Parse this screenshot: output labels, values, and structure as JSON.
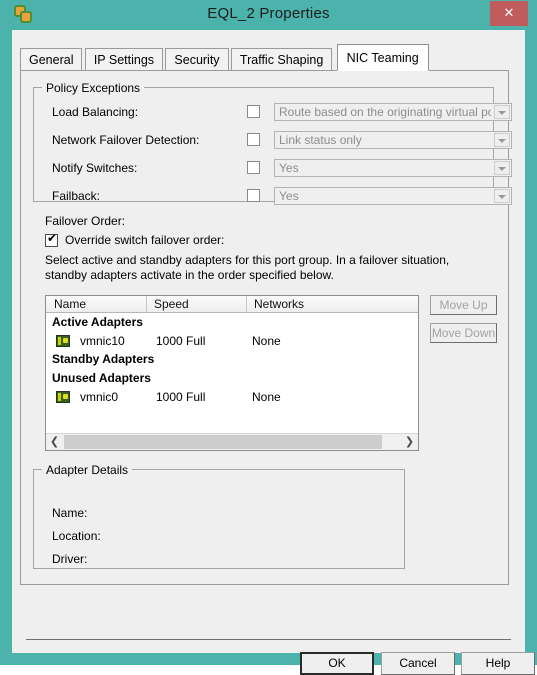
{
  "window": {
    "title": "EQL_2 Properties",
    "icon": "vsphere-link-icon",
    "close_label": "✕",
    "accent_color": "#4cb3ac",
    "close_color": "#c15c5c"
  },
  "tabs": [
    {
      "label": "General",
      "active": false
    },
    {
      "label": "IP Settings",
      "active": false
    },
    {
      "label": "Security",
      "active": false
    },
    {
      "label": "Traffic Shaping",
      "active": false
    },
    {
      "label": "NIC Teaming",
      "active": true
    }
  ],
  "policy_exceptions": {
    "title": "Policy Exceptions",
    "rows": [
      {
        "label": "Load Balancing:",
        "checked": false,
        "value": "Route based on the originating virtual port ID"
      },
      {
        "label": "Network Failover Detection:",
        "checked": false,
        "value": "Link status only"
      },
      {
        "label": "Notify Switches:",
        "checked": false,
        "value": "Yes"
      },
      {
        "label": "Failback:",
        "checked": false,
        "value": "Yes"
      }
    ]
  },
  "failover_order": {
    "label": "Failover Order:",
    "override_label": "Override switch failover order:",
    "override_checked": true,
    "override_mark": "✔",
    "description": "Select active and standby adapters for this port group.  In a failover situation, standby adapters activate  in the order specified below."
  },
  "adapter_table": {
    "columns": [
      "Name",
      "Speed",
      "Networks"
    ],
    "groups": [
      {
        "heading": "Active Adapters",
        "rows": [
          {
            "icon": "network-adapter-icon",
            "name": "vmnic10",
            "speed": "1000 Full",
            "networks": "None"
          }
        ]
      },
      {
        "heading": "Standby Adapters",
        "rows": []
      },
      {
        "heading": "Unused Adapters",
        "rows": [
          {
            "icon": "network-adapter-icon",
            "name": "vmnic0",
            "speed": "1000 Full",
            "networks": "None"
          }
        ]
      }
    ],
    "scroll_left_glyph": "❮",
    "scroll_right_glyph": "❯"
  },
  "move_buttons": {
    "up": "Move Up",
    "down": "Move Down"
  },
  "adapter_details": {
    "title": "Adapter Details",
    "fields": [
      {
        "label": "Name:",
        "value": ""
      },
      {
        "label": "Location:",
        "value": ""
      },
      {
        "label": "Driver:",
        "value": ""
      }
    ]
  },
  "dialog_buttons": {
    "ok": "OK",
    "cancel": "Cancel",
    "help": "Help"
  }
}
